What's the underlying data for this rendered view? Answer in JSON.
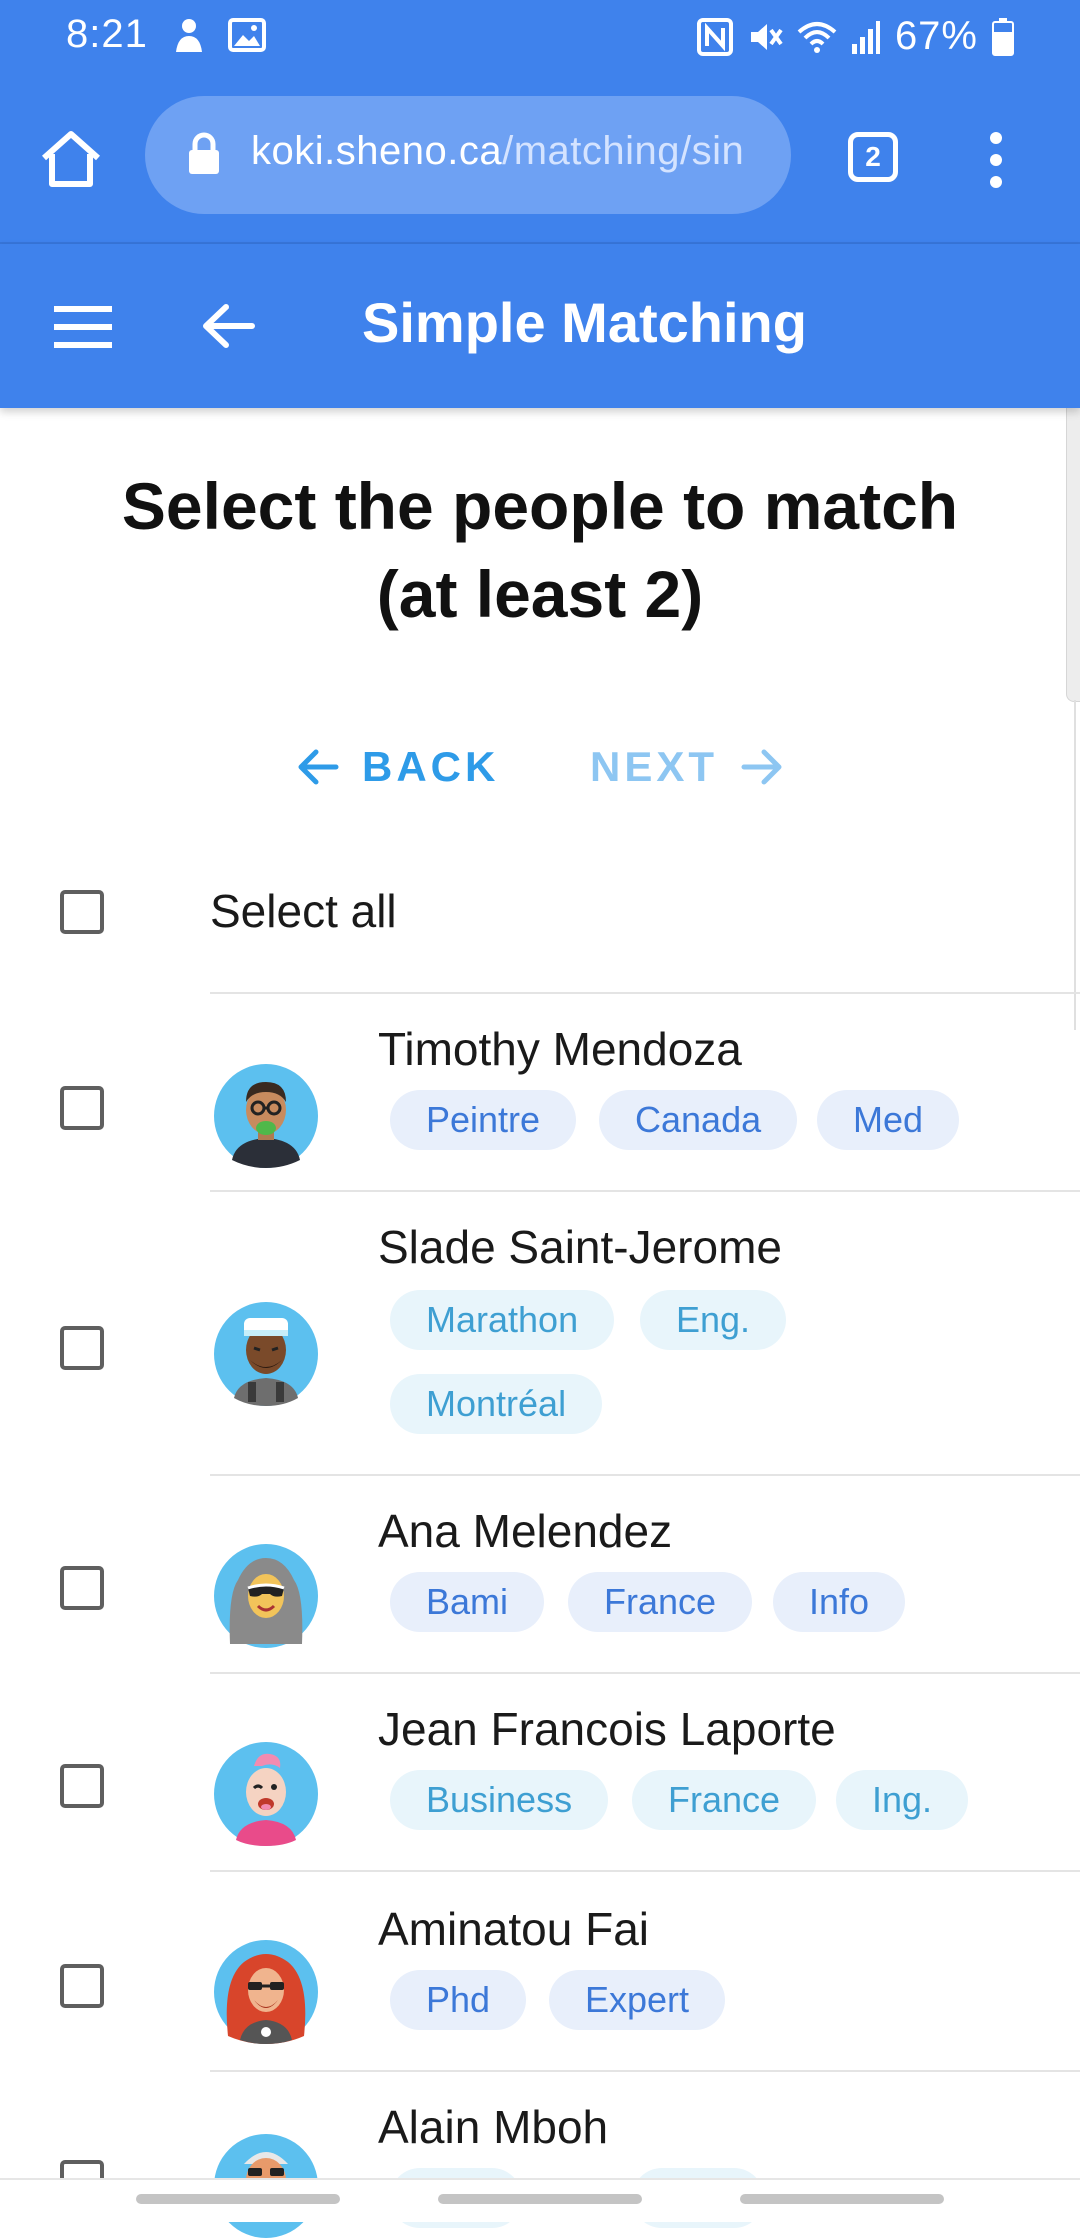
{
  "status_bar": {
    "time": "8:21",
    "battery": "67%"
  },
  "browser": {
    "url_host": "koki.sheno.ca",
    "url_path": "/matching/sin",
    "tab_count": "2"
  },
  "app_bar": {
    "title": "Simple Matching"
  },
  "heading": {
    "line1": "Select the people to match",
    "line2": "(at least 2)"
  },
  "nav": {
    "back": "BACK",
    "next": "NEXT"
  },
  "select_all": {
    "label": "Select all"
  },
  "people": [
    {
      "name": "Timothy Mendoza",
      "tags": [
        "Peintre",
        "Canada",
        "Med"
      ]
    },
    {
      "name": "Slade Saint-Jerome",
      "tags": [
        "Marathon",
        "Eng.",
        "Montréal"
      ]
    },
    {
      "name": "Ana Melendez",
      "tags": [
        "Bami",
        "France",
        "Info"
      ]
    },
    {
      "name": "Jean Francois Laporte",
      "tags": [
        "Business",
        "France",
        "Ing."
      ]
    },
    {
      "name": "Aminatou Fai",
      "tags": [
        "Phd",
        "Expert"
      ]
    },
    {
      "name": "Alain Mboh",
      "tags": []
    }
  ],
  "colors": {
    "primary": "#3f82ec",
    "accent": "#2e9be8",
    "chip_blue_bg": "#e8effb",
    "chip_blue_text": "#3c78d8",
    "chip_teal_bg": "#e8f5fb",
    "chip_teal_text": "#3e9fd2"
  }
}
